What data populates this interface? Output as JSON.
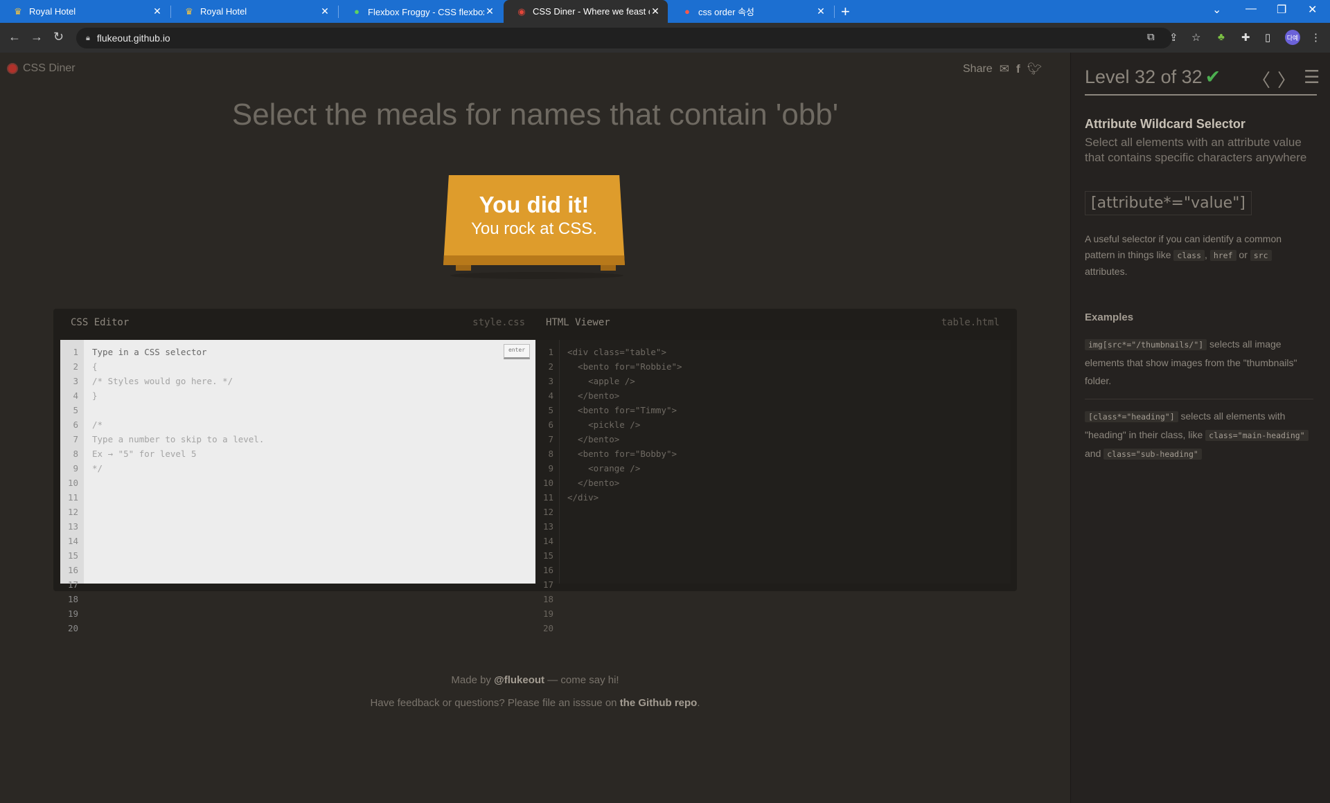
{
  "browser": {
    "tabs": [
      {
        "title": "Royal Hotel",
        "icon": "crown-icon",
        "active": false
      },
      {
        "title": "Royal Hotel",
        "icon": "crown-icon",
        "active": false
      },
      {
        "title": "Flexbox Froggy - CSS flexbox 배",
        "icon": "frog-icon",
        "active": false
      },
      {
        "title": "CSS Diner - Where we feast on",
        "icon": "css-diner-icon",
        "active": true
      },
      {
        "title": "css order 속성",
        "icon": "tistory-icon",
        "active": false
      }
    ],
    "url": "flukeout.github.io",
    "profile": "다예"
  },
  "app": {
    "name": "CSS Diner",
    "share_label": "Share",
    "order": "Select the meals for names that contain 'obb'",
    "win_line1": "You did it!",
    "win_line2": "You rock at CSS."
  },
  "editor": {
    "css_title": "CSS Editor",
    "css_file": "style.css",
    "html_title": "HTML Viewer",
    "html_file": "table.html",
    "enter_label": "enter",
    "line_count": 20,
    "css_lines": [
      "Type in a CSS selector",
      "{",
      "/* Styles would go here. */",
      "}",
      "",
      "/*",
      "Type a number to skip to a level.",
      "Ex → \"5\" for level 5",
      "*/"
    ],
    "html_lines": [
      "<div class=\"table\">",
      "  <bento for=\"Robbie\">",
      "    <apple />",
      "  </bento>",
      "  <bento for=\"Timmy\">",
      "    <pickle />",
      "  </bento>",
      "  <bento for=\"Bobby\">",
      "    <orange />",
      "  </bento>",
      "</div>"
    ]
  },
  "footer": {
    "made_prefix": "Made by ",
    "made_handle": "@flukeout",
    "made_suffix": " — come say hi!",
    "feedback_prefix": "Have feedback or questions? Please file an isssue on ",
    "feedback_link": "the Github repo",
    "feedback_suffix": "."
  },
  "sidebar": {
    "level_text": "Level 32 of 32",
    "level_current": 32,
    "level_total": 32,
    "selector_title": "Attribute Wildcard Selector",
    "description": "Select all elements with an attribute value that contains specific characters anywhere",
    "syntax": "[attribute*=\"value\"]",
    "hint_prefix": "A useful selector if you can identify a common pattern in things like ",
    "hint_code1": "class",
    "hint_sep1": ", ",
    "hint_code2": "href",
    "hint_sep2": " or ",
    "hint_code3": "src",
    "hint_suffix": " attributes.",
    "examples_heading": "Examples",
    "ex1_code": "img[src*=\"/thumbnails/\"]",
    "ex1_text": " selects all image elements that show images from the \"thumbnails\" folder.",
    "ex2_code": "[class*=\"heading\"]",
    "ex2_text": " selects all elements with \"heading\" in their class, like ",
    "ex2_code2": "class=\"main-heading\"",
    "ex2_and": " and ",
    "ex2_code3": "class=\"sub-heading\""
  },
  "colors": {
    "tabbar": "#1c6fd1",
    "background": "#2b2824",
    "table": "#de9c2c",
    "check": "#4caf50"
  }
}
